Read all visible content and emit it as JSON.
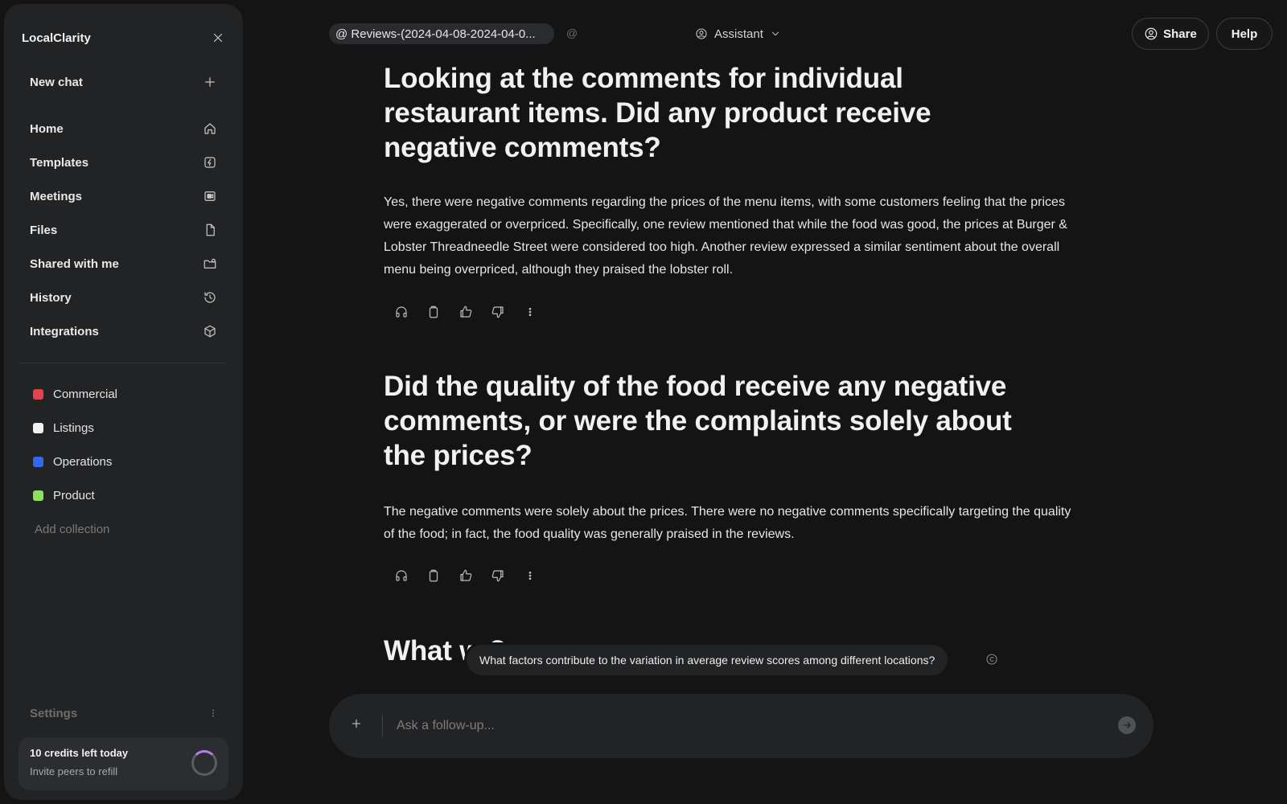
{
  "sidebar": {
    "brand": "LocalClarity",
    "new_chat": "New chat",
    "nav": [
      {
        "label": "Home",
        "icon": "home-icon"
      },
      {
        "label": "Templates",
        "icon": "lightning-icon"
      },
      {
        "label": "Meetings",
        "icon": "video-icon"
      },
      {
        "label": "Files",
        "icon": "file-icon"
      },
      {
        "label": "Shared with me",
        "icon": "shared-folder-icon"
      },
      {
        "label": "History",
        "icon": "history-icon"
      },
      {
        "label": "Integrations",
        "icon": "cube-icon"
      }
    ],
    "collections": [
      {
        "label": "Commercial",
        "color": "#e5414e"
      },
      {
        "label": "Listings",
        "color": "#f2f2f2"
      },
      {
        "label": "Operations",
        "color": "#3466f0"
      },
      {
        "label": "Product",
        "color": "#8fe060"
      }
    ],
    "add_collection": "Add collection",
    "settings": "Settings",
    "credits_title": "10 credits left today",
    "credits_sub": "Invite peers to refill"
  },
  "topbar": {
    "source_pill": "@ Reviews-(2024-04-08-2024-04-0...",
    "mention_symbol": "@",
    "assistant": "Assistant",
    "share": "Share",
    "help": "Help"
  },
  "thread": [
    {
      "question": "Looking at the comments for individual restaurant items. Did any product receive negative comments?",
      "answer": "Yes, there were negative comments regarding the prices of the menu items, with some customers feeling that the prices were exaggerated or overpriced. Specifically, one review mentioned that while the food was good, the prices at Burger & Lobster Threadneedle Street were considered too high. Another review expressed a similar sentiment about the overall menu being overpriced, although they praised the lobster roll."
    },
    {
      "question": "Did the quality of the food receive any negative comments, or were the complaints solely about the prices?",
      "answer": "The negative comments were solely about the prices. There were no negative comments specifically targeting the quality of the food; in fact, the food quality was generally praised in the reviews."
    }
  ],
  "pending_question_partial": "What w                                                   ?",
  "suggestion": "What factors contribute to the variation in average review scores among different locations?",
  "composer": {
    "placeholder": "Ask a follow-up..."
  }
}
